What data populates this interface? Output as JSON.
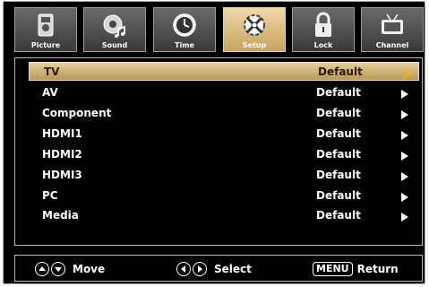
{
  "tabs": [
    {
      "label": "Picture",
      "icon": "picture-icon",
      "active": false
    },
    {
      "label": "Sound",
      "icon": "sound-icon",
      "active": false
    },
    {
      "label": "Time",
      "icon": "clock-icon",
      "active": false
    },
    {
      "label": "Setup",
      "icon": "setup-tools-icon",
      "active": true
    },
    {
      "label": "Lock",
      "icon": "padlock-icon",
      "active": false
    },
    {
      "label": "Channel",
      "icon": "tv-channel-icon",
      "active": false
    }
  ],
  "menu": {
    "items": [
      {
        "name": "TV",
        "value": "Default",
        "selected": true
      },
      {
        "name": "AV",
        "value": "Default"
      },
      {
        "name": "Component",
        "value": "Default"
      },
      {
        "name": "HDMI1",
        "value": "Default"
      },
      {
        "name": "HDMI2",
        "value": "Default"
      },
      {
        "name": "HDMI3",
        "value": "Default"
      },
      {
        "name": "PC",
        "value": "Default"
      },
      {
        "name": "Media",
        "value": "Default"
      }
    ]
  },
  "footer": {
    "move_label": "Move",
    "select_label": "Select",
    "menu_key": "MENU",
    "return_label": "Return"
  },
  "colors": {
    "active_gold": "#d8bb7d",
    "background": "#000000",
    "text": "#ffffff"
  }
}
